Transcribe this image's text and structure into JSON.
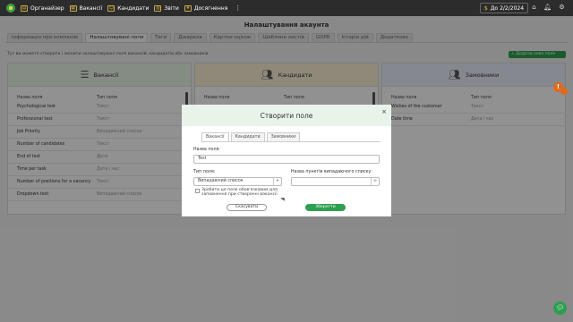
{
  "topbar": {
    "items": [
      {
        "label": "Органайзер",
        "icon": "organizer-icon"
      },
      {
        "label": "Вакансії",
        "icon": "vacancies-icon"
      },
      {
        "label": "Кандидати",
        "icon": "candidates-icon"
      },
      {
        "label": "Звіти",
        "icon": "reports-icon"
      },
      {
        "label": "Досягнення",
        "icon": "achievements-icon"
      }
    ],
    "more": "⋮",
    "date_label": "До 2/2/2024"
  },
  "page": {
    "title": "Налаштування акаунта",
    "tabs": [
      "Інформація про компанію",
      "Налаштовувані поля",
      "Теги",
      "Джерела",
      "Картки оцінок",
      "Шаблони листів",
      "GDPR",
      "Історія дій",
      "Додатково"
    ],
    "active_tab": 1,
    "info_text": "Тут ви можете створити і змінити налаштовувані поля вакансій, кандидатів або замовників",
    "add_button": "+ Додати нове поле"
  },
  "columns": [
    {
      "title": "Вакансії",
      "col_name": "Назва поля",
      "col_type": "Тип поля",
      "rows": [
        {
          "name": "Psychological test",
          "type": "Текст"
        },
        {
          "name": "Professional test",
          "type": "Текст"
        },
        {
          "name": "Job Priority",
          "type": "Випадаючий список"
        },
        {
          "name": "Number of candidates",
          "type": "Текст"
        },
        {
          "name": "End of test",
          "type": "Дата"
        },
        {
          "name": "Time per task",
          "type": "Дата і час"
        },
        {
          "name": "Number of positions for a vacancy",
          "type": "Текст"
        },
        {
          "name": "Dropdown test",
          "type": "Випадаючий список"
        }
      ]
    },
    {
      "title": "Кандидати",
      "col_name": "Назва поля",
      "col_type": "Тип поля",
      "rows": []
    },
    {
      "title": "Замовники",
      "col_name": "Назва поля",
      "col_type": "Тип поля",
      "rows": [
        {
          "name": "Wishes of the customer",
          "type": "Текст"
        },
        {
          "name": "Date time",
          "type": "Дата і час"
        }
      ]
    }
  ],
  "modal": {
    "title": "Створити поле",
    "close": "×",
    "tabs": [
      "Вакансії",
      "Кандидати",
      "Замовники"
    ],
    "active_tab": 0,
    "name_label": "Назва поля:",
    "name_value": "Test",
    "type_label": "Тип поля:",
    "type_value": "Випадаючий список",
    "dropdown_label": "Назва пунктів випадаючого списку:",
    "dropdown_value": "",
    "checkbox_label": "Зробити це поле обов'язковим для заповнення при створенні вакансії",
    "cancel": "Скасувати",
    "save": "Зберегти"
  },
  "alert_badge": "!",
  "colors": {
    "accent": "#2f9e4f",
    "topbar": "#2c2c2c",
    "warning": "#e06a1d"
  }
}
